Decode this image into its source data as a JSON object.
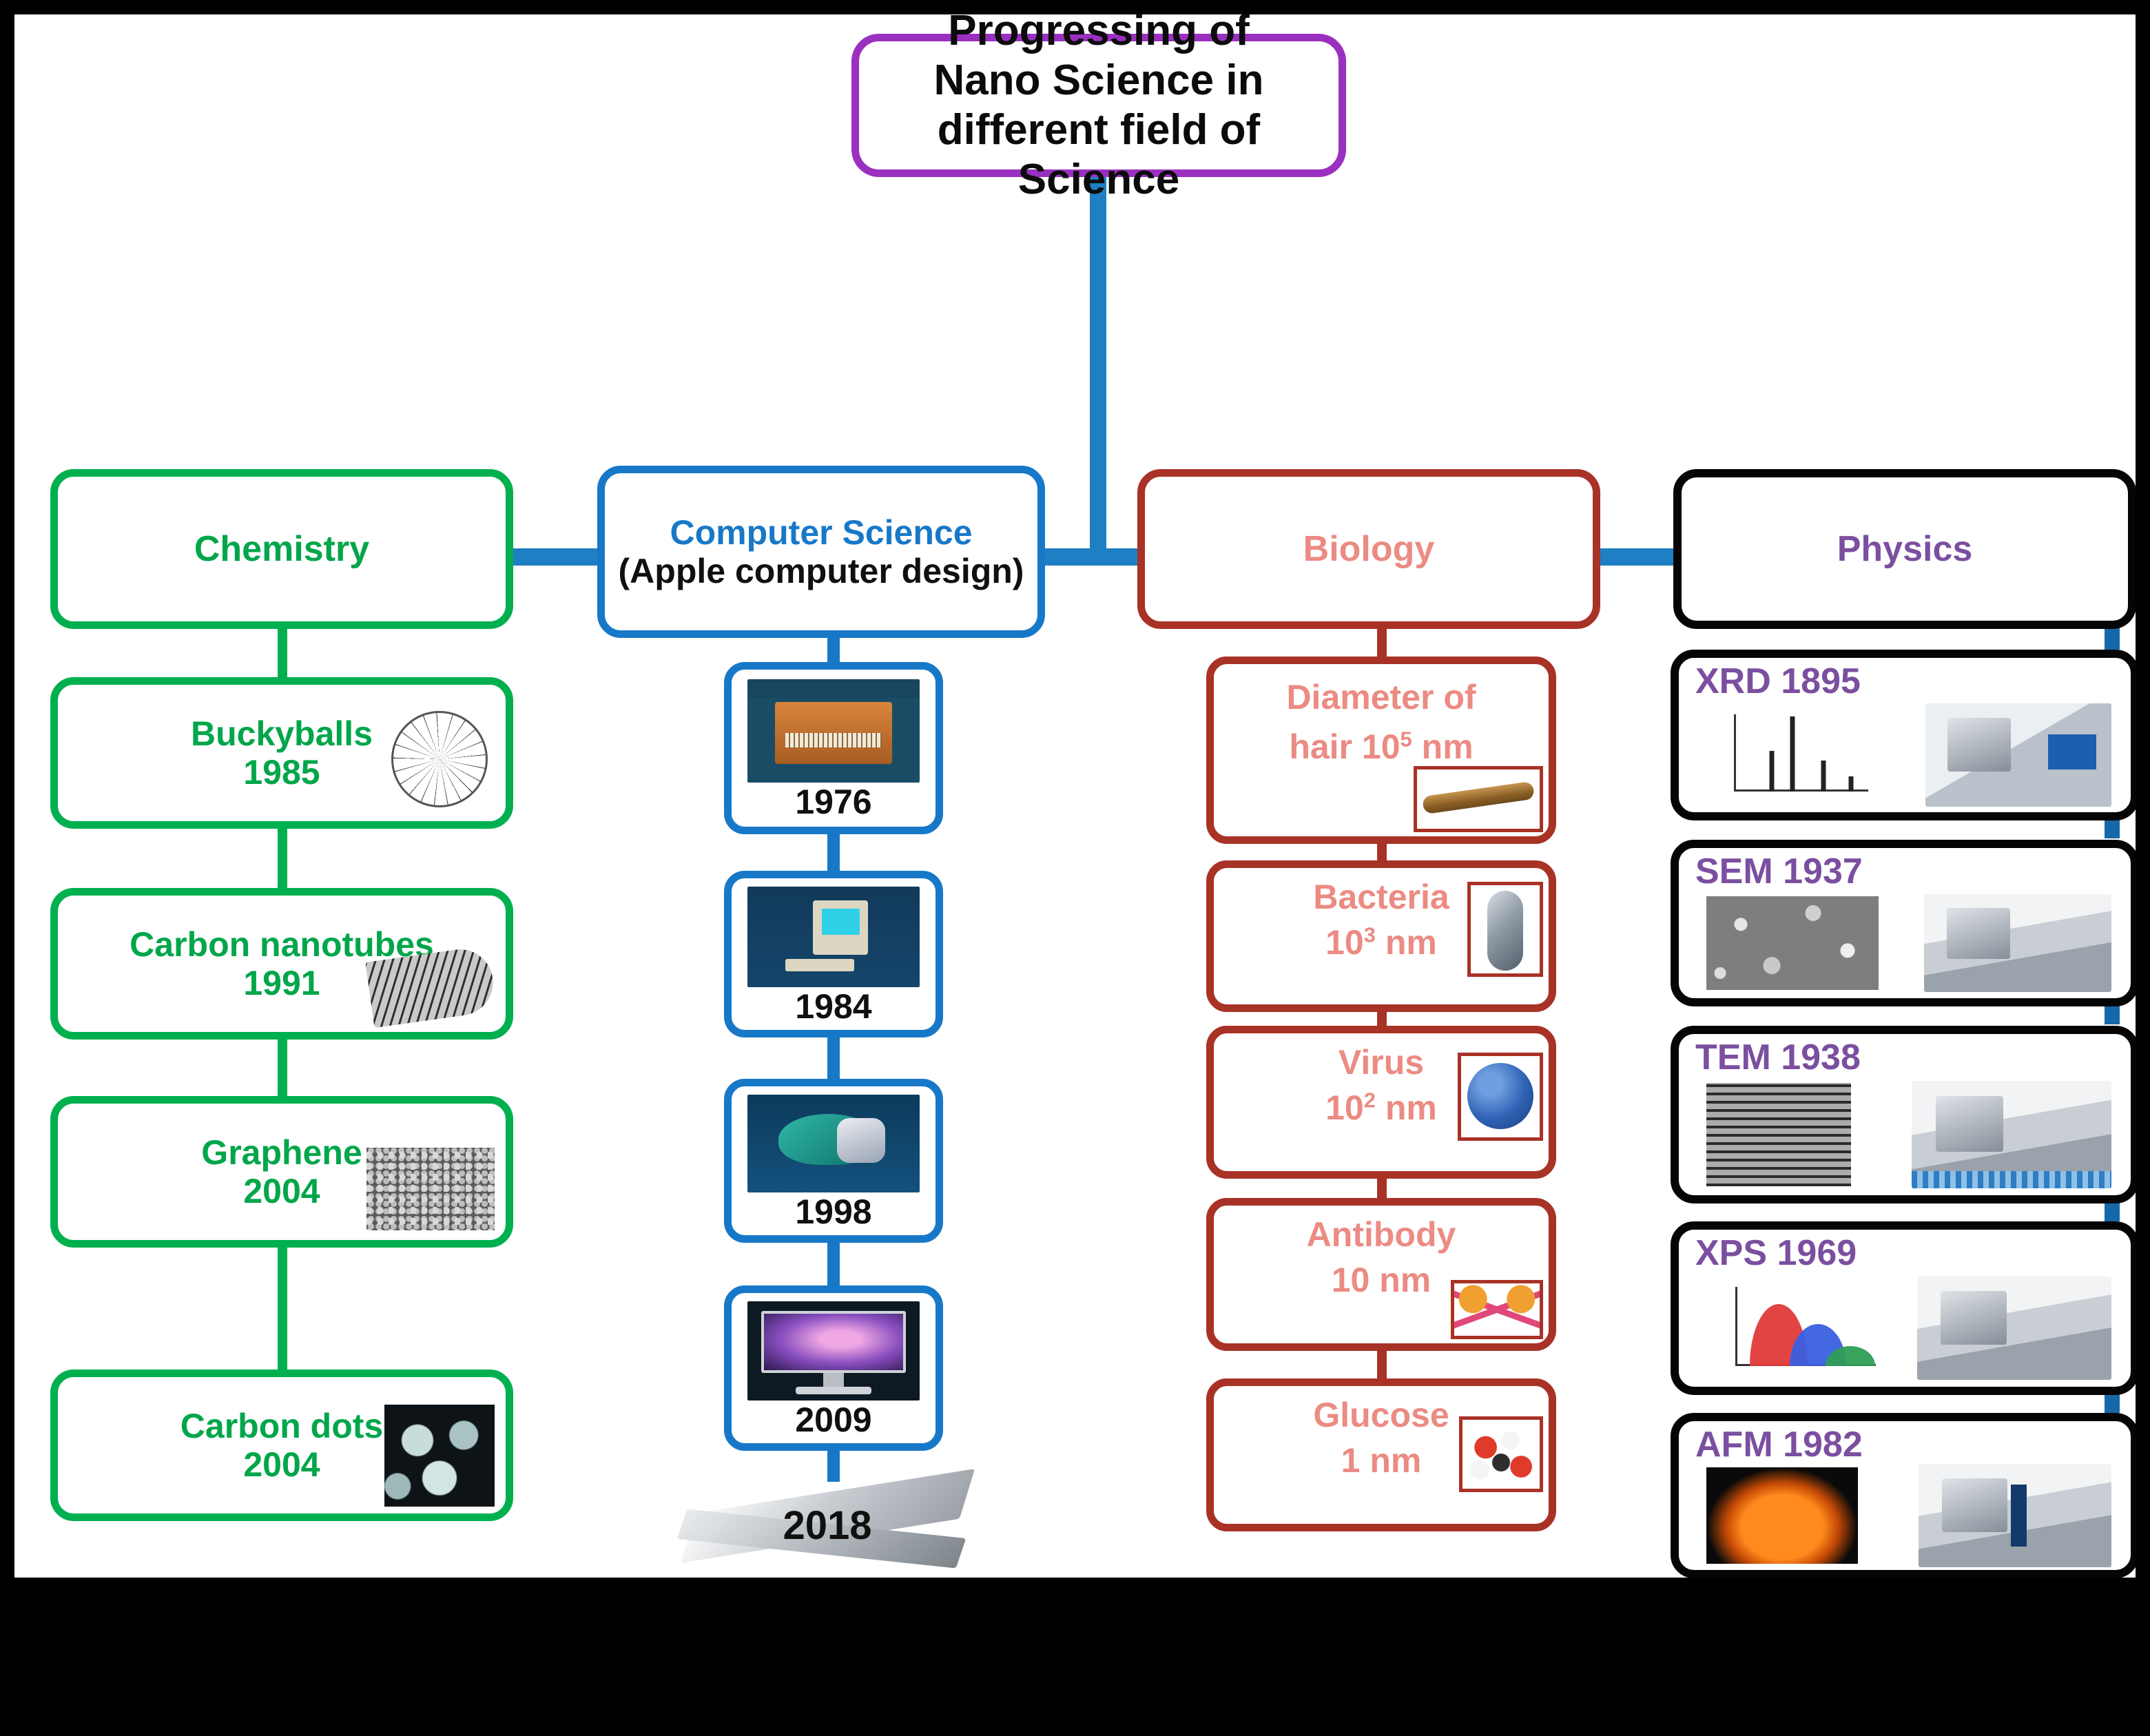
{
  "title": {
    "line1": "Progressing of",
    "line2": "Nano Science in",
    "line3": "different field of",
    "line4": "Science"
  },
  "colors": {
    "title_border": "#9A30C0",
    "chemistry": "#00B04F",
    "computer_science": "#1878C8",
    "biology_border": "#A93226",
    "biology_text": "#EB8B83",
    "physics_border": "#050505",
    "physics_text": "#7B4FA0",
    "connector_blue": "#1F7FC4",
    "page_frame": "#000000"
  },
  "columns": {
    "chemistry": {
      "header": "Chemistry",
      "items": [
        {
          "name": "Buckyballs",
          "year": "1985",
          "image": "buckyball-icon"
        },
        {
          "name": "Carbon nanotubes",
          "year": "1991",
          "image": "nanotube-icon"
        },
        {
          "name": "Graphene",
          "year": "2004",
          "image": "graphene-lattice-icon"
        },
        {
          "name": "Carbon dots",
          "year": "2004",
          "image": "carbon-dots-sem-icon"
        }
      ]
    },
    "computer_science": {
      "header_title": "Computer Science",
      "header_subtitle": "(Apple computer design)",
      "items": [
        {
          "year": "1976",
          "image": "apple-i-computer-icon"
        },
        {
          "year": "1984",
          "image": "macintosh-128k-icon"
        },
        {
          "year": "1998",
          "image": "imac-g3-icon"
        },
        {
          "year": "2009",
          "image": "imac-aluminium-icon"
        },
        {
          "year": "2018",
          "image": "macbook-laptop-icon"
        }
      ]
    },
    "biology": {
      "header": "Biology",
      "items": [
        {
          "label_line1": "Diameter of",
          "label_line2": "hair 10",
          "exponent": "5",
          "unit": " nm",
          "image": "hair-strand-icon"
        },
        {
          "label_line1": "Bacteria",
          "label_line2": "10",
          "exponent": "3",
          "unit": " nm",
          "image": "bacteria-rod-icon"
        },
        {
          "label_line1": "Virus",
          "label_line2": "10",
          "exponent": "2",
          "unit": " nm",
          "image": "virus-capsid-icon"
        },
        {
          "label_line1": "Antibody",
          "label_line2": "10",
          "exponent": "",
          "unit": " nm",
          "image": "antibody-icon"
        },
        {
          "label_line1": "Glucose",
          "label_line2": "1",
          "exponent": "",
          "unit": " nm",
          "image": "glucose-molecule-icon"
        }
      ]
    },
    "physics": {
      "header": "Physics",
      "items": [
        {
          "label": "XRD 1895",
          "technique": "XRD",
          "year": "1895",
          "image_left": "xrd-diffractogram-icon",
          "image_right": "xrd-instrument-icon"
        },
        {
          "label": "SEM 1937",
          "technique": "SEM",
          "year": "1937",
          "image_left": "sem-micrograph-icon",
          "image_right": "sem-instrument-icon"
        },
        {
          "label": "TEM 1938",
          "technique": "TEM",
          "year": "1938",
          "image_left": "tem-micrograph-icon",
          "image_right": "tem-instrument-icon"
        },
        {
          "label": "XPS 1969",
          "technique": "XPS",
          "year": "1969",
          "image_left": "xps-spectrum-icon",
          "image_right": "xps-instrument-icon"
        },
        {
          "label": "AFM 1982",
          "technique": "AFM",
          "year": "1982",
          "image_left": "afm-topography-icon",
          "image_right": "afm-instrument-icon"
        }
      ]
    }
  }
}
